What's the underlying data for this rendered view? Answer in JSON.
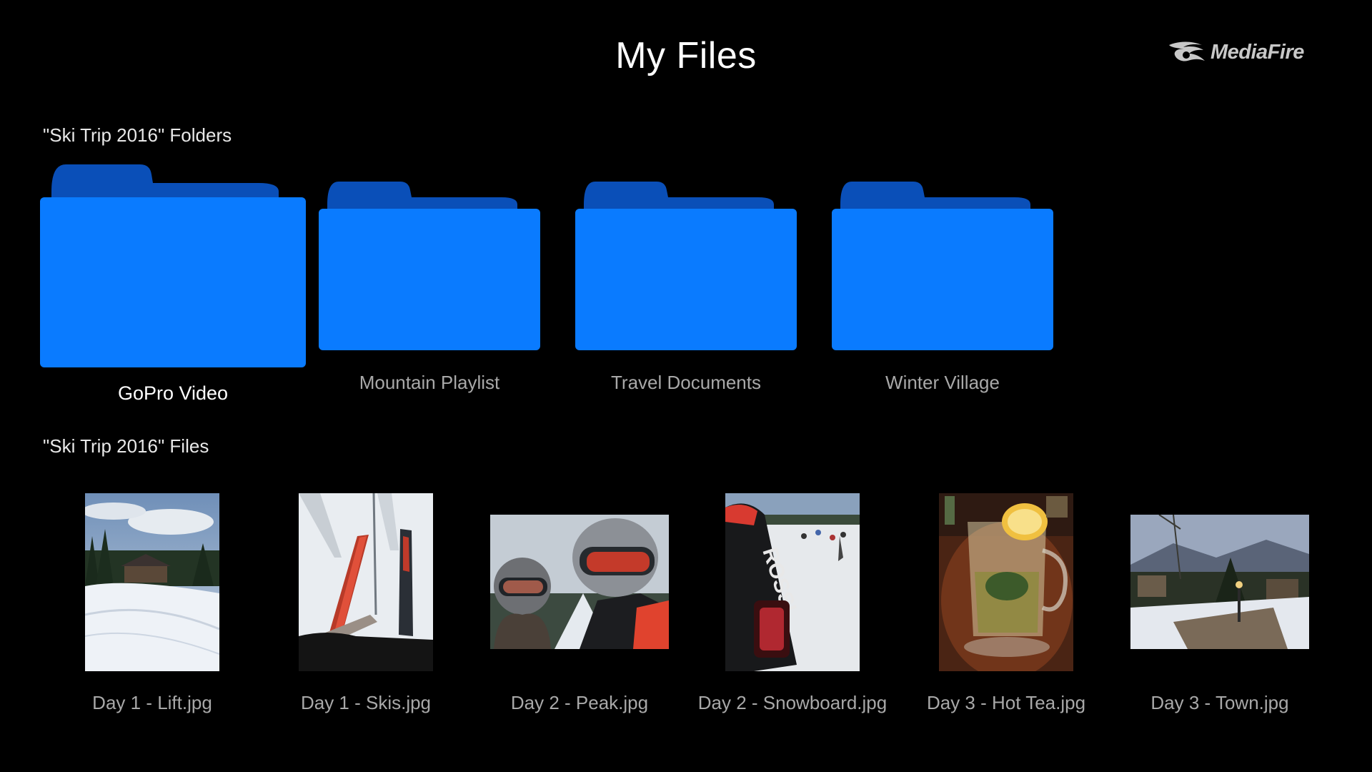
{
  "header": {
    "title": "My Files",
    "brand": "MediaFire"
  },
  "folders_section": {
    "heading": "\"Ski Trip 2016\" Folders",
    "items": [
      {
        "label": "GoPro Video",
        "focused": true,
        "icon": "folder-icon"
      },
      {
        "label": "Mountain Playlist",
        "focused": false,
        "icon": "folder-icon"
      },
      {
        "label": "Travel Documents",
        "focused": false,
        "icon": "folder-icon"
      },
      {
        "label": "Winter Village",
        "focused": false,
        "icon": "folder-icon"
      }
    ]
  },
  "files_section": {
    "heading": "\"Ski Trip 2016\" Files",
    "items": [
      {
        "label": "Day 1 - Lift.jpg"
      },
      {
        "label": "Day 1 - Skis.jpg"
      },
      {
        "label": "Day 2 - Peak.jpg"
      },
      {
        "label": "Day 2 - Snowboard.jpg"
      },
      {
        "label": "Day 3 - Hot Tea.jpg"
      },
      {
        "label": "Day 3 - Town.jpg"
      }
    ]
  },
  "colors": {
    "background": "#000000",
    "folder_front": "#0a7bff",
    "folder_back": "#0a4fb8",
    "label_focused": "#ffffff",
    "label_normal": "#a8a8a8"
  }
}
